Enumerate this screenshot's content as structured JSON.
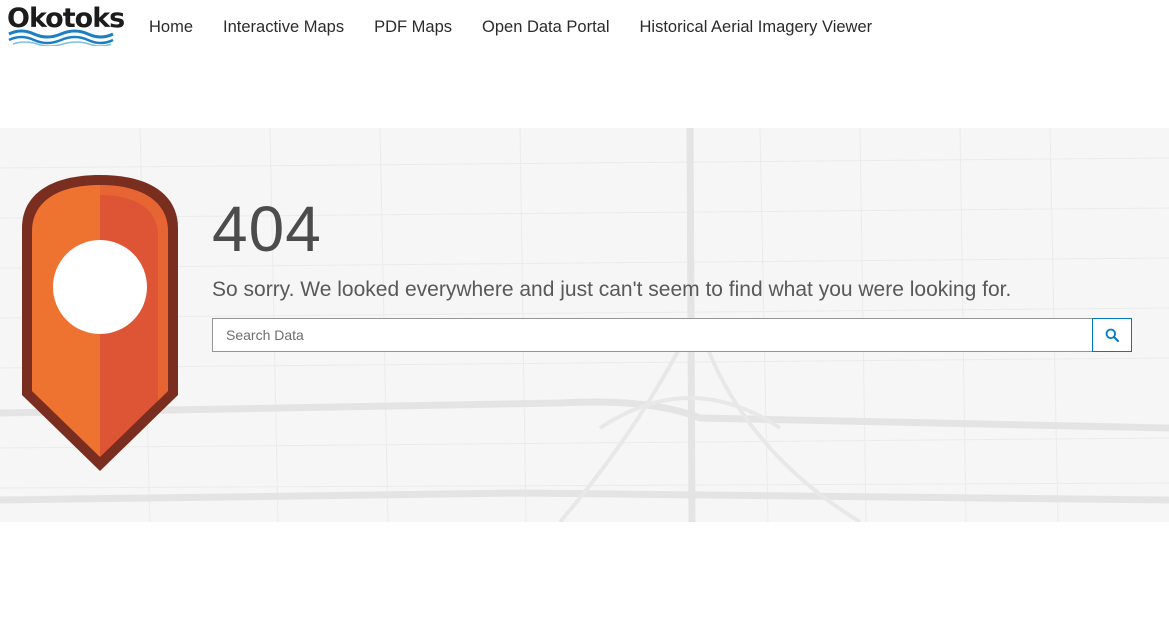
{
  "header": {
    "logo_text": "Okotoks",
    "nav": [
      {
        "label": "Home"
      },
      {
        "label": "Interactive Maps"
      },
      {
        "label": "PDF Maps"
      },
      {
        "label": "Open Data Portal"
      },
      {
        "label": "Historical Aerial Imagery Viewer"
      }
    ]
  },
  "error": {
    "code": "404",
    "message": "So sorry. We looked everywhere and just can't seem to find what you were looking for."
  },
  "search": {
    "placeholder": "Search Data",
    "value": "",
    "button_icon": "search-icon"
  },
  "colors": {
    "pin_outer": "#7a2e1f",
    "pin_left": "#ee7330",
    "pin_right": "#dd5535",
    "accent": "#0079c1",
    "logo_wave_blue": "#1b7fc4"
  }
}
